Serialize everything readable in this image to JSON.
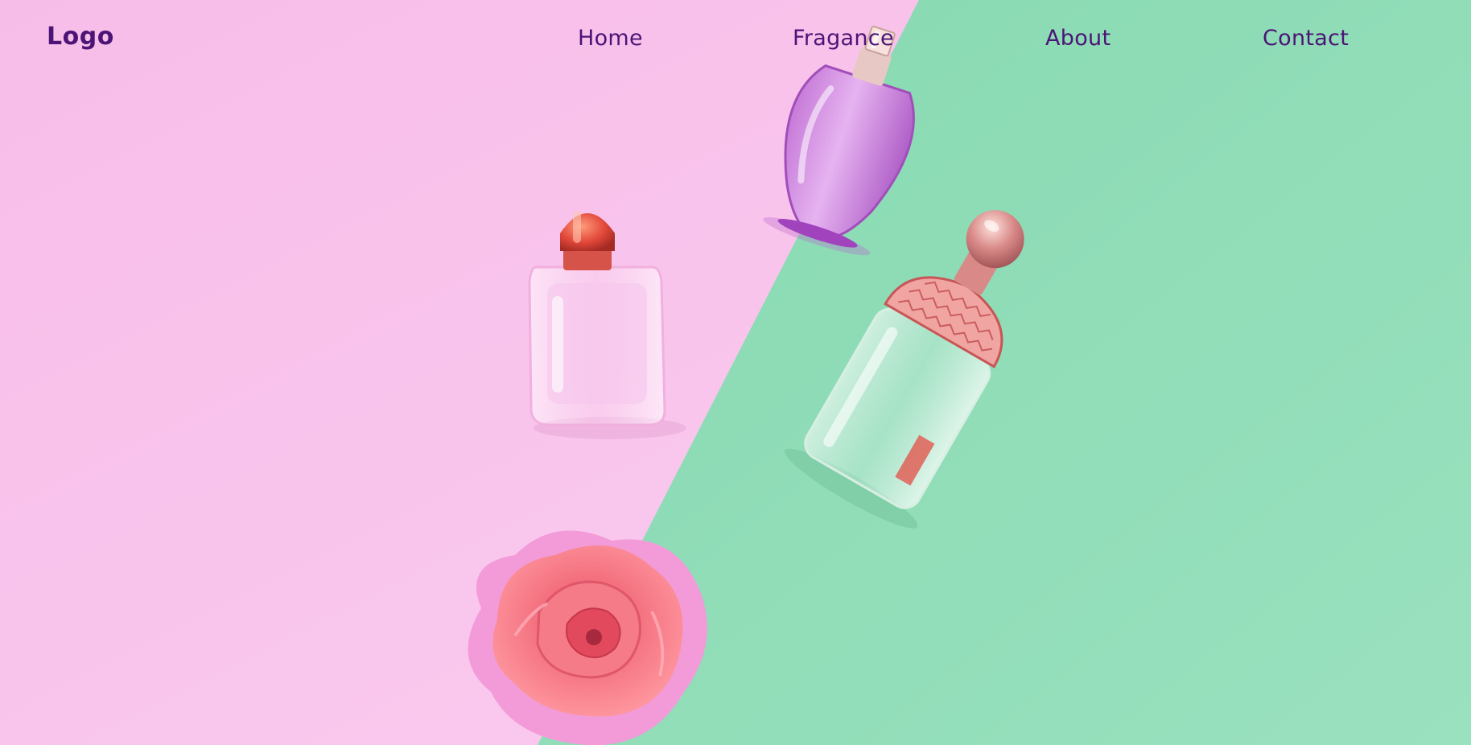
{
  "nav": {
    "logo": "Logo",
    "links": [
      {
        "label": "Home"
      },
      {
        "label": "Fragance"
      },
      {
        "label": "About"
      },
      {
        "label": "Contact"
      }
    ]
  },
  "colors": {
    "pink_background": "#f9c5ee",
    "mint_background": "#8fdcb7",
    "nav_text": "#4b1476"
  },
  "hero_image": {
    "elements": [
      "square-perfume-bottle-icon",
      "purple-perfume-bottle-icon",
      "honeycomb-perfume-bottle-icon",
      "pink-rose-icon"
    ]
  }
}
